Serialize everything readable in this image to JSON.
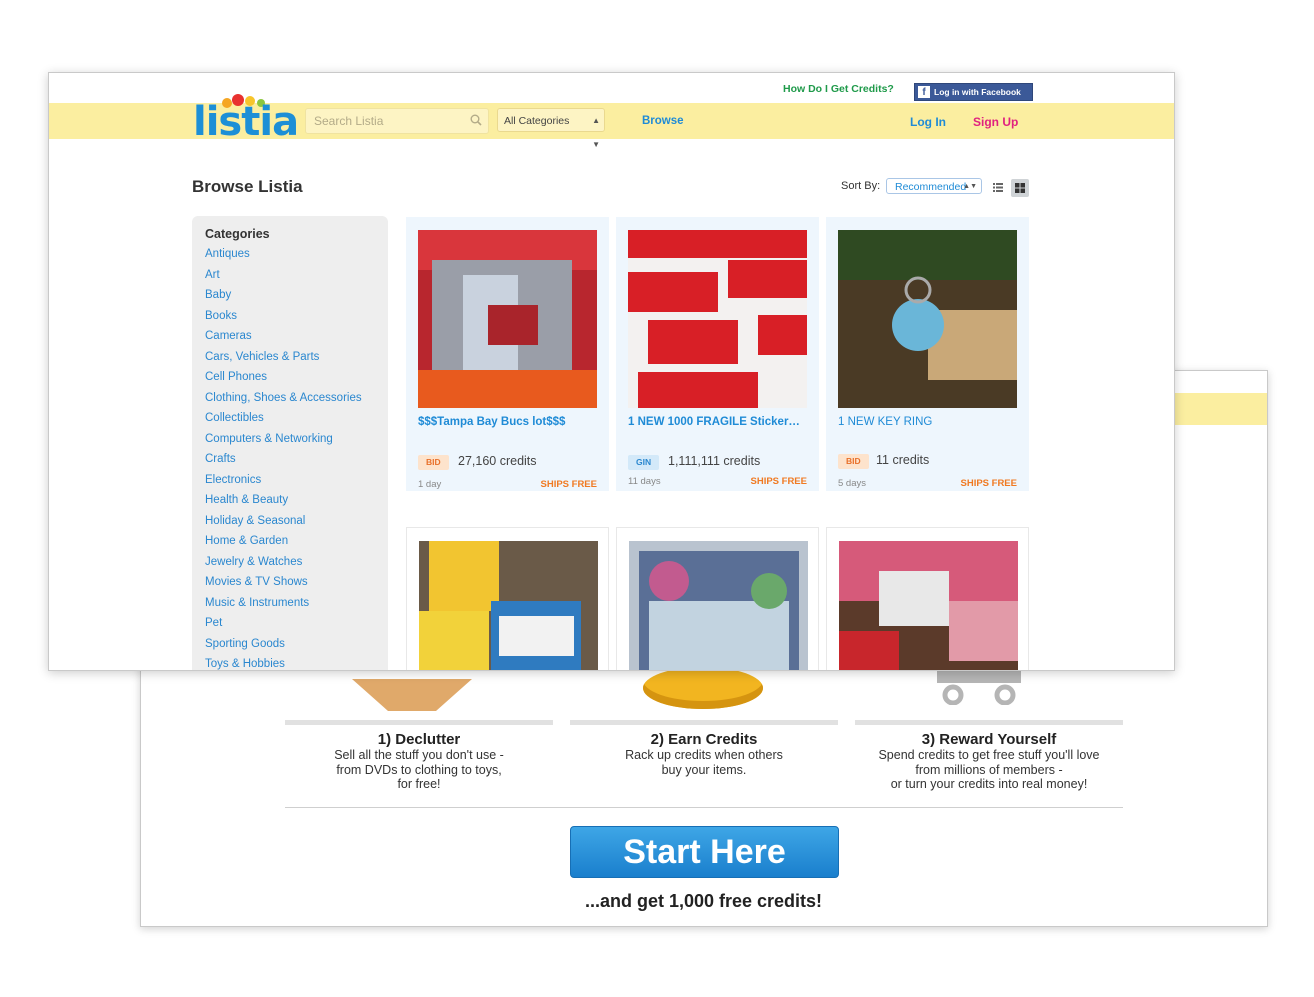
{
  "back": {
    "steps": [
      {
        "title": "1) Declutter",
        "lines": [
          "Sell all the stuff you don't use -",
          "from DVDs to clothing to toys,",
          "for free!"
        ]
      },
      {
        "title": "2) Earn Credits",
        "lines": [
          "Rack up credits when others",
          "buy your items."
        ]
      },
      {
        "title": "3) Reward Yourself",
        "lines": [
          "Spend credits to get free stuff you'll love",
          "from millions of members -",
          "or turn your credits into real money!"
        ]
      }
    ],
    "cta_label": "Start Here",
    "cta_sub": "...and get 1,000 free credits!"
  },
  "header": {
    "logo": "listia",
    "how_link": "How Do I Get Credits?",
    "fb_label": "Log in with Facebook",
    "search_placeholder": "Search Listia",
    "category_select": "All Categories",
    "browse": "Browse",
    "login": "Log In",
    "signup": "Sign Up"
  },
  "page": {
    "title": "Browse Listia",
    "sort_label": "Sort By:",
    "sort_value": "Recommended"
  },
  "sidebar": {
    "title": "Categories",
    "items": [
      "Antiques",
      "Art",
      "Baby",
      "Books",
      "Cameras",
      "Cars, Vehicles & Parts",
      "Cell Phones",
      "Clothing, Shoes & Accessories",
      "Collectibles",
      "Computers & Networking",
      "Crafts",
      "Electronics",
      "Health & Beauty",
      "Holiday & Seasonal",
      "Home & Garden",
      "Jewelry & Watches",
      "Movies & TV Shows",
      "Music & Instruments",
      "Pet",
      "Sporting Goods",
      "Toys & Hobbies"
    ]
  },
  "listings": [
    {
      "title": "$$$Tampa Bay Bucs lot$$$",
      "badge": "BID",
      "credits": "27,160 credits",
      "age": "1 day",
      "ships": "SHIPS FREE"
    },
    {
      "title": "1 NEW 1000 FRAGILE Sticker…",
      "badge": "GIN",
      "credits": "1,111,111 credits",
      "age": "11 days",
      "ships": "SHIPS FREE"
    },
    {
      "title": "1 NEW KEY RING",
      "badge": "BID",
      "credits": "11 credits",
      "age": "5 days",
      "ships": "SHIPS FREE"
    }
  ],
  "colors": {
    "header_yellow": "#fbeea0",
    "link_blue": "#1f8bd6",
    "signup_pink": "#e0217f",
    "ships_orange": "#f07a22"
  }
}
